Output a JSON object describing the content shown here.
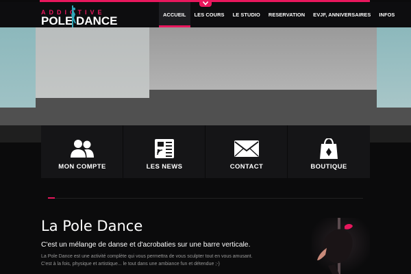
{
  "brand": {
    "logo_top": "ADDICTIVE",
    "logo_bottom": "POLE DANCE",
    "accent_color": "#e8175d"
  },
  "nav": {
    "items": [
      {
        "label": "ACCUEIL",
        "active": true
      },
      {
        "label": "LES COURS",
        "active": false
      },
      {
        "label": "LE STUDIO",
        "active": false
      },
      {
        "label": "RESERVATION",
        "active": false
      },
      {
        "label": "EVJF, ANNIVERSAIRES",
        "active": false
      },
      {
        "label": "INFOS",
        "active": false
      }
    ],
    "toggle_icon": "chevron-down-icon"
  },
  "tiles": [
    {
      "label": "MON COMPTE",
      "icon": "users-icon"
    },
    {
      "label": "LES NEWS",
      "icon": "newspaper-icon"
    },
    {
      "label": "CONTACT",
      "icon": "envelope-icon"
    },
    {
      "label": "BOUTIQUE",
      "icon": "shopping-bag-icon"
    }
  ],
  "content": {
    "title": "La Pole Dance",
    "subtitle": "C'est un mélange de danse et d'acrobaties sur une barre verticale.",
    "paragraph_line1": "La Pole Dance est une activité complète qui vous permettra de vous sculpter tout en vous amusant.",
    "paragraph_line2": "C'est à la fois, physique et artistique... le tout dans une ambiance fun et détendue ;-)"
  }
}
